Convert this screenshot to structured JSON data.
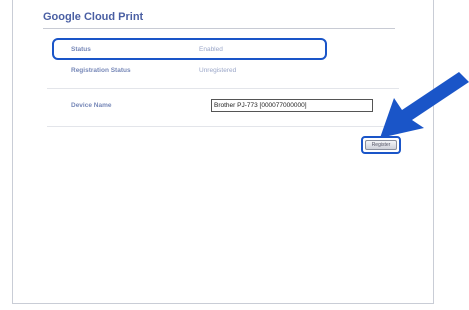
{
  "page": {
    "title": "Google Cloud Print"
  },
  "rows": {
    "status": {
      "label": "Status",
      "value": "Enabled"
    },
    "registration_status": {
      "label": "Registration Status",
      "value": "Unregistered"
    },
    "device_name": {
      "label": "Device Name",
      "value": "Brother PJ-773 [000077000000]"
    }
  },
  "buttons": {
    "register_label": "Register"
  },
  "colors": {
    "accent": "#1a55c8",
    "title": "#4a5fa3"
  },
  "icons": {
    "callout": "arrow-pointer-icon"
  }
}
